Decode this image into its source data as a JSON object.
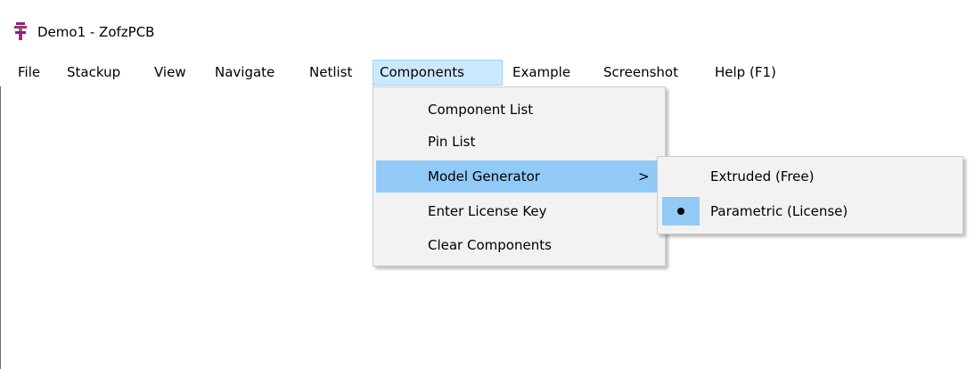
{
  "window": {
    "title": "Demo1 - ZofzPCB"
  },
  "menubar": {
    "items": [
      {
        "label": "File"
      },
      {
        "label": "Stackup"
      },
      {
        "label": "View"
      },
      {
        "label": "Navigate"
      },
      {
        "label": "Netlist"
      },
      {
        "label": "Components",
        "active": true
      },
      {
        "label": "Example"
      },
      {
        "label": "Screenshot"
      },
      {
        "label": "Help (F1)"
      }
    ]
  },
  "components_menu": {
    "items": [
      {
        "label": "Component List"
      },
      {
        "label": "Pin List"
      },
      {
        "label": "Model Generator",
        "submenu_arrow": ">",
        "highlighted": true
      },
      {
        "label": "Enter License Key"
      },
      {
        "label": "Clear Components"
      }
    ]
  },
  "model_generator_submenu": {
    "items": [
      {
        "label": "Extruded (Free)",
        "selected": false
      },
      {
        "label": "Parametric (License)",
        "selected": true
      }
    ]
  },
  "colors": {
    "menu_active_bg": "#cce8ff",
    "menu_active_border": "#99d1ff",
    "menu_highlight": "#91c9f7",
    "menu_bg": "#f2f2f2"
  },
  "icons": {
    "app": "zofzpcb-app-icon",
    "submenu_arrow": "chevron-right-icon",
    "radio_dot": "radio-dot-icon"
  }
}
